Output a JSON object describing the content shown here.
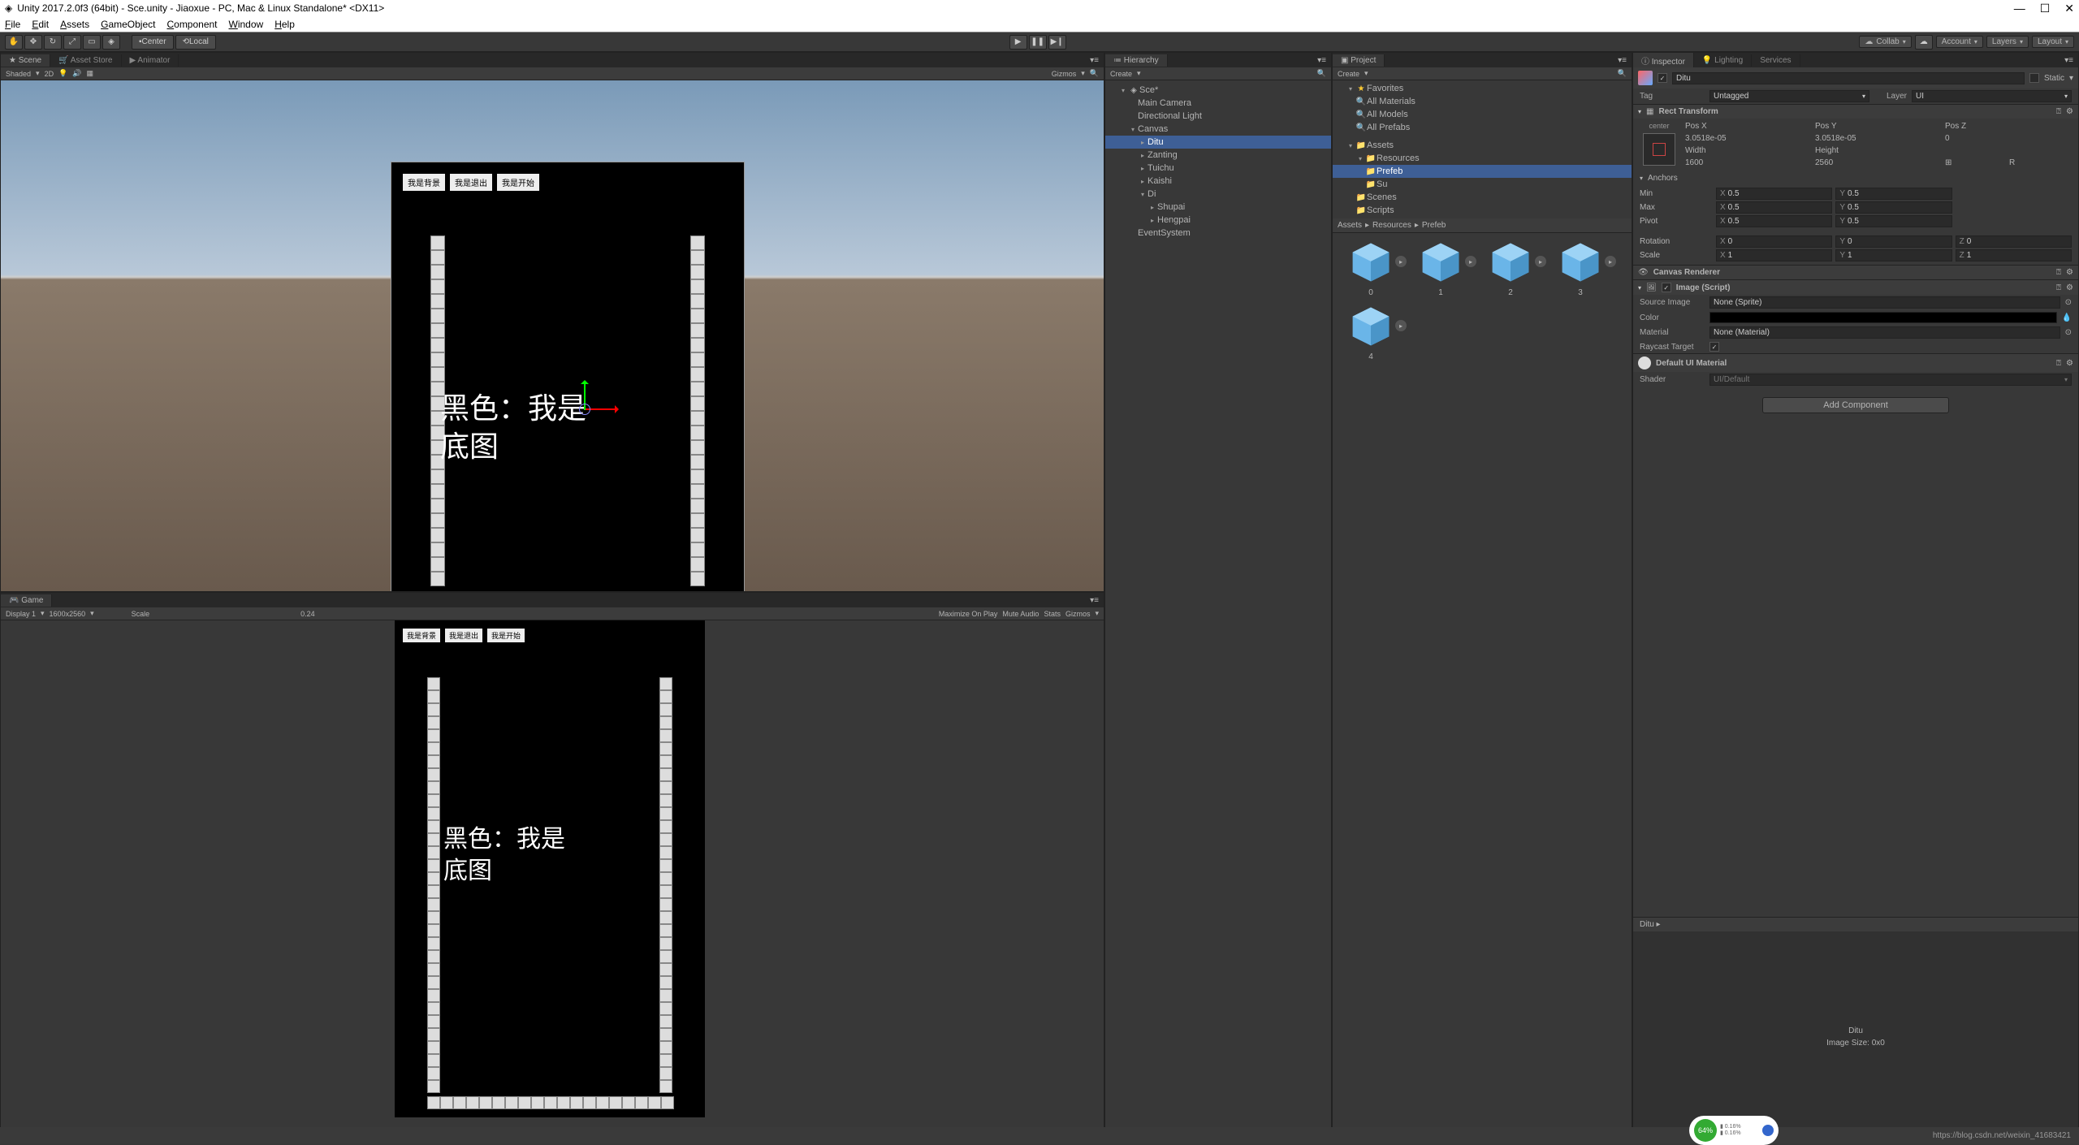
{
  "title": "Unity 2017.2.0f3 (64bit) - Sce.unity - Jiaoxue - PC, Mac & Linux Standalone* <DX11>",
  "menus": [
    "File",
    "Edit",
    "Assets",
    "GameObject",
    "Component",
    "Window",
    "Help"
  ],
  "toolbar": {
    "center": "Center",
    "local": "Local",
    "collab": "Collab",
    "account": "Account",
    "layers": "Layers",
    "layout": "Layout"
  },
  "scene": {
    "tab_scene": "Scene",
    "tab_asset": "Asset Store",
    "tab_anim": "Animator",
    "shaded": "Shaded",
    "twod": "2D",
    "gizmos": "Gizmos",
    "btn1": "我是背景",
    "btn2": "我是退出",
    "btn3": "我是开始",
    "maintext": "黑色：我是底图"
  },
  "game": {
    "tab": "Game",
    "display": "Display 1",
    "res": "1600x2560",
    "scale": "Scale",
    "scaleval": "0.24",
    "max": "Maximize On Play",
    "mute": "Mute Audio",
    "stats": "Stats",
    "gizmos": "Gizmos",
    "btn1": "我是背景",
    "btn2": "我是退出",
    "btn3": "我是开始",
    "maintext": "黑色：我是底图"
  },
  "hierarchy": {
    "tab": "Hierarchy",
    "create": "Create",
    "root": "Sce*",
    "items": [
      "Main Camera",
      "Directional Light",
      "Canvas",
      "Ditu",
      "Zanting",
      "Tuichu",
      "Kaishi",
      "Di",
      "Shupai",
      "Hengpai",
      "EventSystem"
    ]
  },
  "project": {
    "tab": "Project",
    "create": "Create",
    "favorites": "Favorites",
    "allmat": "All Materials",
    "allmod": "All Models",
    "allpre": "All Prefabs",
    "assets": "Assets",
    "resources": "Resources",
    "prefeb": "Prefeb",
    "su": "Su",
    "scenes": "Scenes",
    "scripts": "Scripts",
    "breadcrumb": [
      "Assets",
      "Resources",
      "Prefeb"
    ],
    "items": [
      "0",
      "1",
      "2",
      "3",
      "4"
    ]
  },
  "inspector": {
    "tab_insp": "Inspector",
    "tab_light": "Lighting",
    "tab_serv": "Services",
    "objname": "Ditu",
    "static": "Static",
    "tag": "Tag",
    "untagged": "Untagged",
    "layer": "Layer",
    "ui": "UI",
    "rect": {
      "title": "Rect Transform",
      "center_label": "center",
      "posx": "Pos X",
      "posy": "Pos Y",
      "posz": "Pos Z",
      "posx_v": "3.0518e-05",
      "posy_v": "3.0518e-05",
      "posz_v": "0",
      "width": "Width",
      "height": "Height",
      "width_v": "1600",
      "height_v": "2560",
      "anchors": "Anchors",
      "min": "Min",
      "max": "Max",
      "pivot": "Pivot",
      "minx": "0.5",
      "miny": "0.5",
      "maxx": "0.5",
      "maxy": "0.5",
      "pivx": "0.5",
      "pivy": "0.5",
      "rotation": "Rotation",
      "rx": "0",
      "ry": "0",
      "rz": "0",
      "scale": "Scale",
      "sx": "1",
      "sy": "1",
      "sz": "1"
    },
    "canvasrend": "Canvas Renderer",
    "image": {
      "title": "Image (Script)",
      "source": "Source Image",
      "source_v": "None (Sprite)",
      "color": "Color",
      "material": "Material",
      "material_v": "None (Material)",
      "raycast": "Raycast Target"
    },
    "defmat": "Default UI Material",
    "shader": "Shader",
    "shader_v": "UI/Default",
    "addcomponent": "Add Component",
    "preview_name": "Ditu ▸",
    "preview_obj": "Ditu",
    "preview_size": "Image Size: 0x0"
  },
  "footer": {
    "url": "https://blog.csdn.net/weixin_41683421",
    "badge": "64%"
  }
}
